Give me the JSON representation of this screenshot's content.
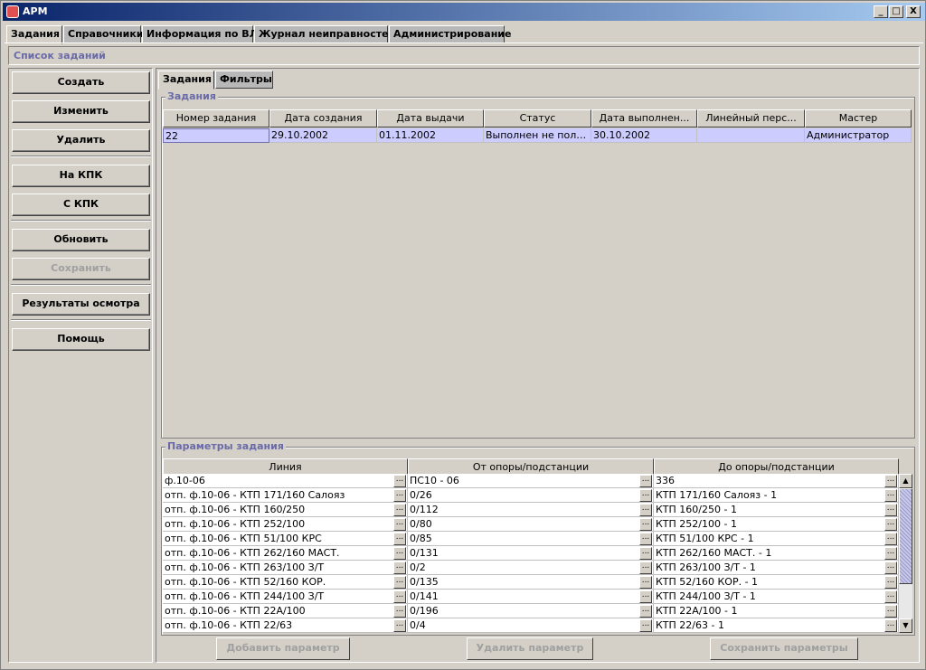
{
  "window": {
    "title": "АРМ",
    "minimize": "_",
    "maximize": "□",
    "close": "X"
  },
  "top_tabs": [
    "Задания",
    "Справочники",
    "Информация по ВЛ",
    "Журнал неиправностей",
    "Администрирование"
  ],
  "section_title": "Список заданий",
  "left_buttons": {
    "create": "Создать",
    "edit": "Изменить",
    "delete": "Удалить",
    "to_pda": "На КПК",
    "from_pda": "С КПК",
    "refresh": "Обновить",
    "save": "Сохранить",
    "results": "Результаты осмотра",
    "help": "Помощь"
  },
  "inner_tabs": [
    "Задания",
    "Фильтры"
  ],
  "tasks": {
    "title": "Задания",
    "columns": [
      "Номер задания",
      "Дата создания",
      "Дата выдачи",
      "Статус",
      "Дата выполнен...",
      "Линейный перс...",
      "Мастер"
    ],
    "rows": [
      [
        "22",
        "29.10.2002",
        "01.11.2002",
        "Выполнен не полн...",
        "30.10.2002",
        "",
        "Администратор"
      ]
    ]
  },
  "params": {
    "title": "Параметры задания",
    "columns": [
      "Линия",
      "От опоры/подстанции",
      "До опоры/подстанции"
    ],
    "ellipsis": "...",
    "rows": [
      [
        "ф.10-06",
        "ПС10 - 06",
        "336"
      ],
      [
        "отп. ф.10-06 - КТП 171/160 Салояз",
        "0/26",
        "КТП 171/160 Салояз - 1"
      ],
      [
        "отп. ф.10-06 - КТП 160/250",
        "0/112",
        "КТП 160/250 - 1"
      ],
      [
        "отп. ф.10-06 - КТП 252/100",
        "0/80",
        "КТП 252/100 - 1"
      ],
      [
        "отп. ф.10-06 - КТП 51/100 КРС",
        "0/85",
        "КТП 51/100 КРС - 1"
      ],
      [
        "отп. ф.10-06 - КТП 262/160  МАСТ.",
        "0/131",
        "КТП 262/160  МАСТ. - 1"
      ],
      [
        "отп. ф.10-06 - КТП 263/100 З/Т",
        "0/2",
        "КТП 263/100 З/Т - 1"
      ],
      [
        "отп. ф.10-06 - КТП 52/160 КОР.",
        "0/135",
        "КТП 52/160 КОР. - 1"
      ],
      [
        "отп. ф.10-06 - КТП 244/100 З/Т",
        "0/141",
        "КТП 244/100 З/Т - 1"
      ],
      [
        "отп. ф.10-06 - КТП 22А/100",
        "0/196",
        "КТП 22А/100 - 1"
      ],
      [
        "отп. ф.10-06 - КТП 22/63",
        "0/4",
        "КТП 22/63 - 1"
      ]
    ],
    "scroll_up": "▲",
    "scroll_down": "▼"
  },
  "bottom_buttons": {
    "add": "Добавить параметр",
    "remove": "Удалить параметр",
    "save": "Сохранить параметры"
  }
}
